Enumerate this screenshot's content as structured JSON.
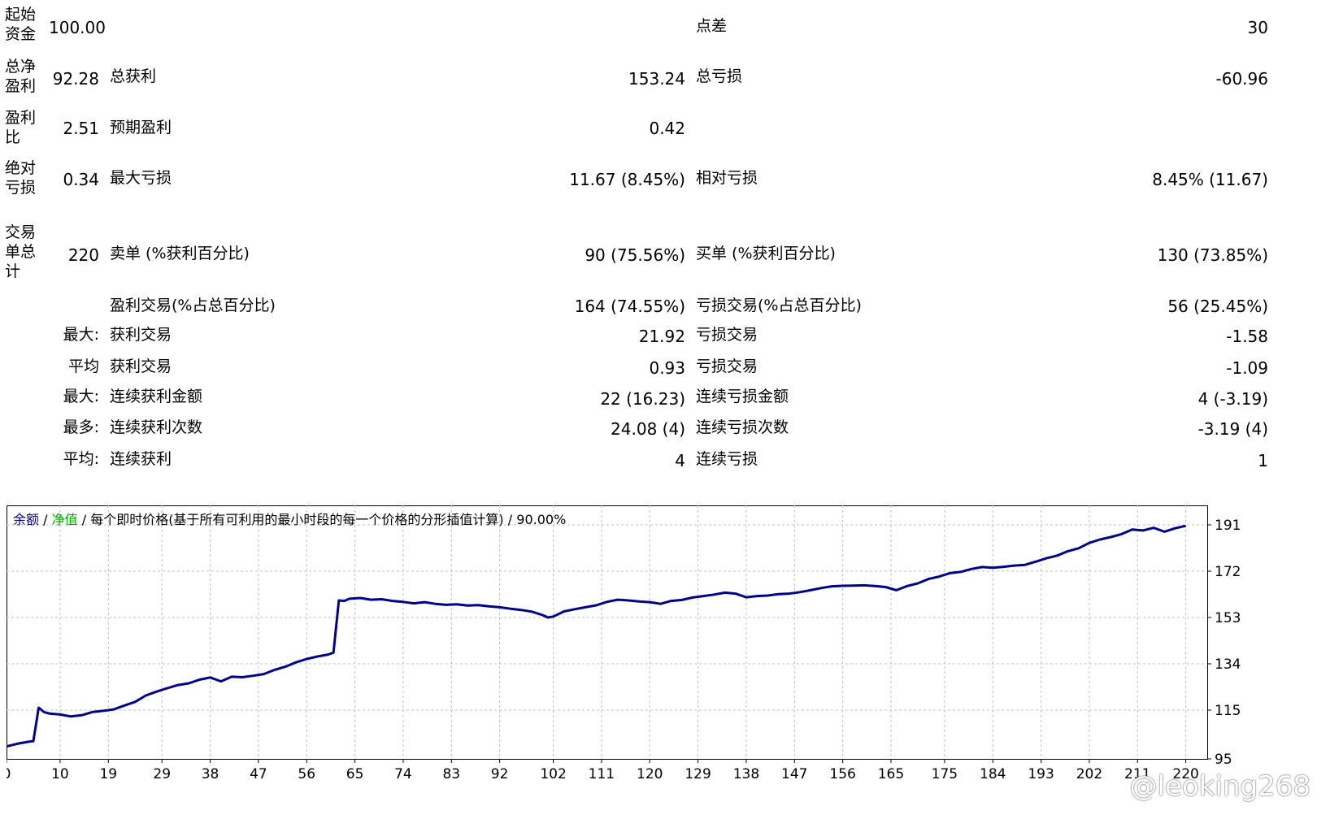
{
  "report": {
    "initial_deposit": {
      "label": "起始资金",
      "value": "100.00"
    },
    "spread": {
      "label": "点差",
      "value": "30"
    },
    "total_net_profit": {
      "label": "总净盈利",
      "value": "92.28"
    },
    "gross_profit": {
      "label": "总获利",
      "value": "153.24"
    },
    "gross_loss": {
      "label": "总亏损",
      "value": "-60.96"
    },
    "profit_factor": {
      "label": "盈利比",
      "value": "2.51"
    },
    "expected_payoff": {
      "label": "预期盈利",
      "value": "0.42"
    },
    "absolute_drawdown": {
      "label": "绝对亏损",
      "value": "0.34"
    },
    "maximal_drawdown": {
      "label": "最大亏损",
      "value": "11.67 (8.45%)"
    },
    "relative_drawdown": {
      "label": "相对亏损",
      "value": "8.45% (11.67)"
    },
    "total_trades": {
      "label": "交易单总计",
      "value": "220"
    },
    "short_positions": {
      "label": "卖单 (%获利百分比)",
      "value": "90 (75.56%)"
    },
    "long_positions": {
      "label": "买单 (%获利百分比)",
      "value": "130 (73.85%)"
    },
    "profit_trades": {
      "label": "盈利交易(%占总百分比)",
      "value": "164 (74.55%)"
    },
    "loss_trades": {
      "label": "亏损交易(%占总百分比)",
      "value": "56 (25.45%)"
    },
    "largest": {
      "prefix": "最大:",
      "profit_label": "获利交易",
      "profit_value": "21.92",
      "loss_label": "亏损交易",
      "loss_value": "-1.58"
    },
    "average": {
      "prefix": "平均",
      "profit_label": "获利交易",
      "profit_value": "0.93",
      "loss_label": "亏损交易",
      "loss_value": "-1.09"
    },
    "max_consecutive": {
      "prefix": "最大:",
      "profit_label": "连续获利金额",
      "profit_value": "22 (16.23)",
      "loss_label": "连续亏损金额",
      "loss_value": "4 (-3.19)"
    },
    "maximal_consecutive": {
      "prefix": "最多:",
      "profit_label": "连续获利次数",
      "profit_value": "24.08 (4)",
      "loss_label": "连续亏损次数",
      "loss_value": "-3.19 (4)"
    },
    "average_consecutive": {
      "prefix": "平均:",
      "profit_label": "连续获利",
      "profit_value": "4",
      "loss_label": "连续亏损",
      "loss_value": "1"
    }
  },
  "legend": {
    "balance": "余额",
    "sep1": "/",
    "equity": "净值",
    "sep2": "/",
    "mode": "每个即时价格(基于所有可利用的最小时段的每一个价格的分形插值计算)",
    "sep3": "/",
    "quality": "90.00%"
  },
  "watermark": "@leoking268",
  "colors": {
    "balance": "#00008b",
    "equity": "#00aa00",
    "grid": "#c0c0c0",
    "legend_text": "#000000"
  },
  "chart_data": {
    "type": "line",
    "title": "",
    "xlabel": "",
    "ylabel": "",
    "x_ticks": [
      0,
      10,
      19,
      29,
      38,
      47,
      56,
      65,
      74,
      83,
      92,
      102,
      111,
      120,
      129,
      138,
      147,
      156,
      165,
      175,
      184,
      193,
      202,
      211,
      220
    ],
    "y_ticks": [
      95,
      115,
      134,
      153,
      172,
      191
    ],
    "xlim": [
      0,
      224
    ],
    "ylim": [
      95,
      199
    ],
    "grid": true,
    "series": [
      {
        "name": "余额",
        "x": [
          0,
          2,
          4,
          5,
          6,
          7,
          8,
          10,
          12,
          14,
          16,
          18,
          20,
          22,
          24,
          26,
          28,
          30,
          32,
          34,
          36,
          38,
          40,
          42,
          44,
          46,
          48,
          50,
          52,
          54,
          56,
          58,
          60,
          61,
          62,
          63,
          64,
          66,
          68,
          70,
          72,
          74,
          76,
          78,
          80,
          82,
          84,
          86,
          88,
          90,
          92,
          94,
          96,
          98,
          100,
          101,
          102,
          104,
          106,
          108,
          110,
          112,
          114,
          116,
          118,
          120,
          122,
          124,
          126,
          128,
          130,
          132,
          134,
          136,
          138,
          140,
          142,
          144,
          146,
          148,
          150,
          152,
          154,
          156,
          158,
          160,
          162,
          164,
          166,
          168,
          170,
          172,
          174,
          176,
          178,
          180,
          182,
          184,
          186,
          188,
          190,
          192,
          194,
          196,
          198,
          200,
          202,
          204,
          206,
          208,
          210,
          212,
          214,
          216,
          218,
          220
        ],
        "values": [
          100.1,
          101.2,
          102.0,
          102.3,
          116.0,
          114.2,
          113.6,
          113.2,
          112.4,
          112.9,
          114.2,
          114.7,
          115.3,
          116.9,
          118.4,
          121.0,
          122.6,
          124.0,
          125.3,
          126.0,
          127.5,
          128.4,
          126.8,
          128.7,
          128.5,
          129.1,
          129.8,
          131.5,
          132.8,
          134.6,
          136.0,
          137.0,
          137.8,
          138.6,
          160.0,
          159.8,
          160.7,
          161.0,
          160.3,
          160.5,
          159.8,
          159.4,
          158.8,
          159.3,
          158.6,
          158.2,
          158.4,
          157.9,
          158.1,
          157.6,
          157.2,
          156.6,
          156.1,
          155.4,
          154.0,
          153.0,
          153.4,
          155.5,
          156.4,
          157.2,
          158.0,
          159.4,
          160.3,
          160.0,
          159.6,
          159.3,
          158.6,
          159.8,
          160.2,
          161.2,
          161.8,
          162.4,
          163.2,
          162.8,
          161.3,
          161.8,
          162.0,
          162.6,
          162.8,
          163.4,
          164.2,
          165.1,
          165.8,
          166.0,
          166.1,
          166.2,
          165.9,
          165.5,
          164.2,
          165.9,
          167.0,
          168.8,
          169.8,
          171.2,
          171.7,
          172.9,
          173.7,
          173.4,
          173.8,
          174.3,
          174.6,
          175.9,
          177.3,
          178.4,
          180.2,
          181.4,
          183.6,
          185.0,
          186.0,
          187.2,
          189.1,
          188.7,
          189.8,
          188.2,
          189.6,
          190.6
        ]
      }
    ]
  }
}
